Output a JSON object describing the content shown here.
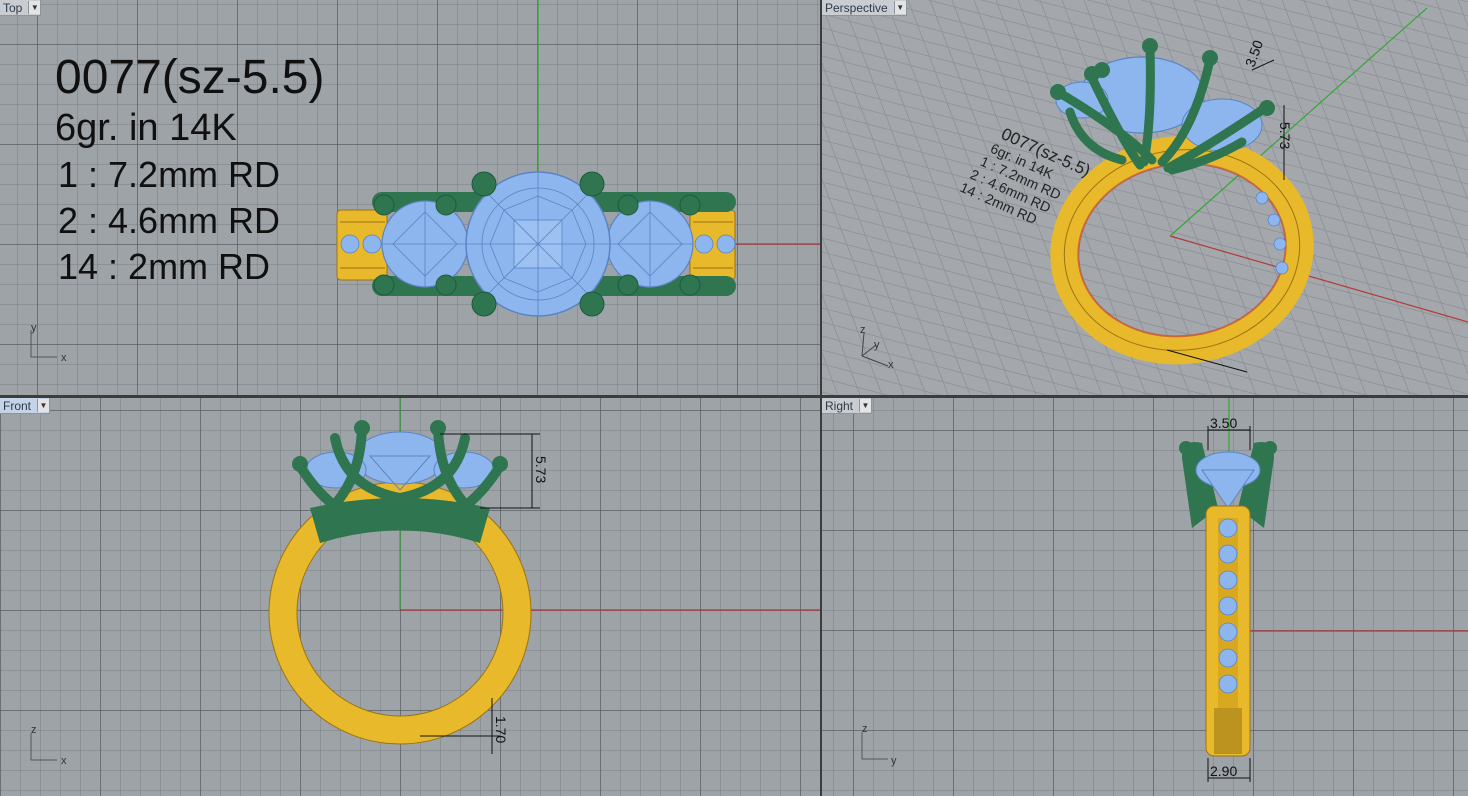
{
  "viewports": {
    "top": {
      "tab": "Top",
      "axes": {
        "v": "y",
        "h": "x"
      }
    },
    "perspective": {
      "tab": "Perspective",
      "axes": {
        "v": "z",
        "d": "y",
        "h": "x"
      }
    },
    "front": {
      "tab": "Front",
      "axes": {
        "v": "z",
        "h": "x"
      }
    },
    "right": {
      "tab": "Right",
      "axes": {
        "v": "z",
        "h": "y"
      }
    }
  },
  "annotation": {
    "model": "0077(sz-5.5)",
    "weight": "6gr.  in 14K",
    "stones": [
      "1 : 7.2mm RD",
      "2 : 4.6mm RD",
      "14 : 2mm RD"
    ]
  },
  "dimensions": {
    "head_height": "5.73",
    "band_thickness": "1.70",
    "head_width": "3.50",
    "shank_width": "2.90"
  },
  "colors": {
    "viewport_bg": "#9ea3a8",
    "gold": "#e8b92a",
    "prong_green": "#2e7550",
    "gem_blue": "#8db6ee",
    "x_axis": "#b23a3a",
    "y_axis": "#3aa63a"
  }
}
